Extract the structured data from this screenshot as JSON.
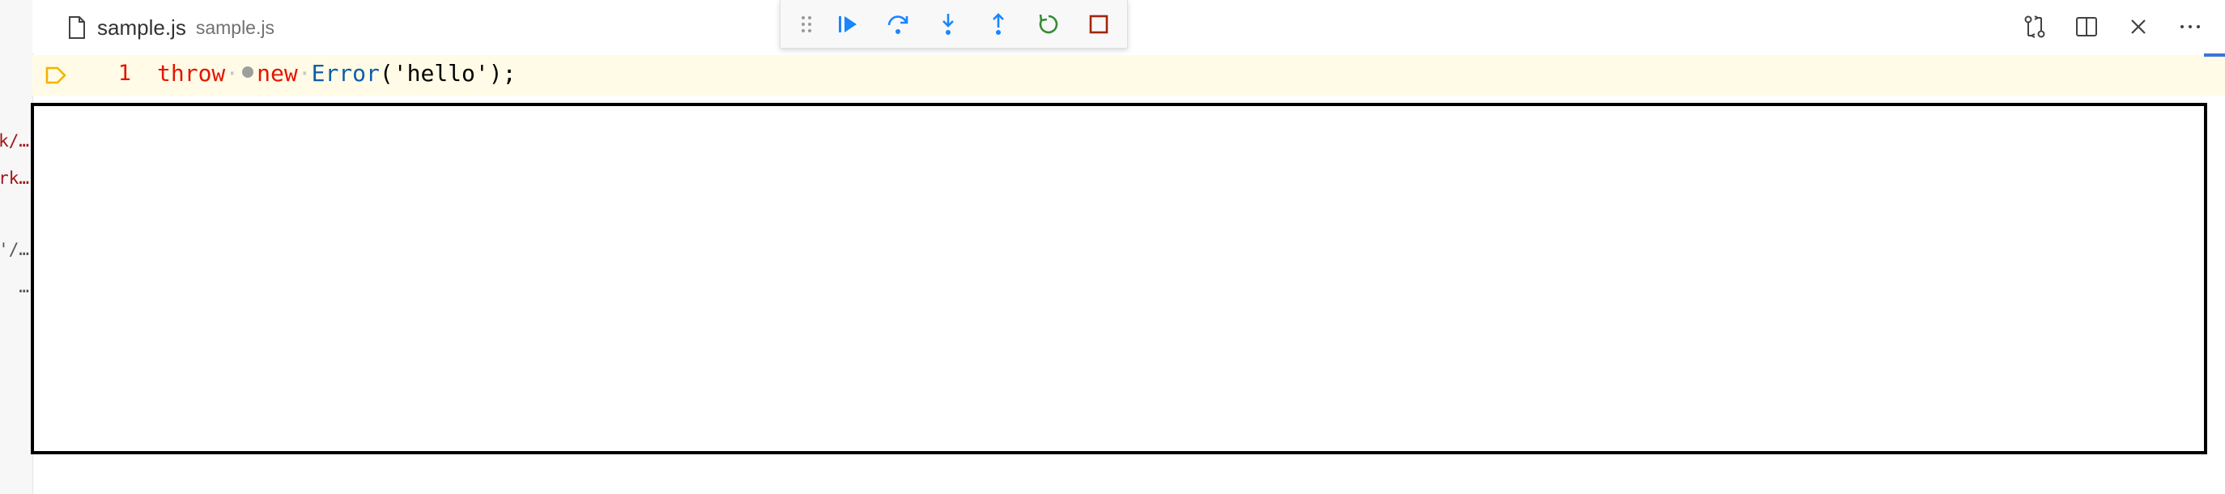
{
  "tab": {
    "name": "sample.js",
    "description": "sample.js",
    "icon": "file-icon"
  },
  "debug_toolbar": {
    "items": [
      {
        "name": "drag-handle-icon"
      },
      {
        "name": "continue-icon"
      },
      {
        "name": "step-over-icon"
      },
      {
        "name": "step-into-icon"
      },
      {
        "name": "step-out-icon"
      },
      {
        "name": "restart-icon"
      },
      {
        "name": "stop-icon"
      }
    ]
  },
  "editor_actions": [
    {
      "name": "open-changes-icon"
    },
    {
      "name": "split-editor-icon"
    },
    {
      "name": "close-icon"
    },
    {
      "name": "more-actions-icon"
    }
  ],
  "editor": {
    "line_number": "1",
    "code": {
      "kw_throw": "throw",
      "kw_new": "new",
      "cls": "Error",
      "rest": "('hello');"
    }
  },
  "left_panel_fragments": [
    "k/…",
    "rk…",
    "'/…",
    "…"
  ],
  "colors": {
    "keyword": "#e51400",
    "class": "#0b5cad",
    "current_line": "#fffbe6",
    "debug_icon": "#1a85ff",
    "restart": "#388a34",
    "stop": "#a1260d"
  }
}
